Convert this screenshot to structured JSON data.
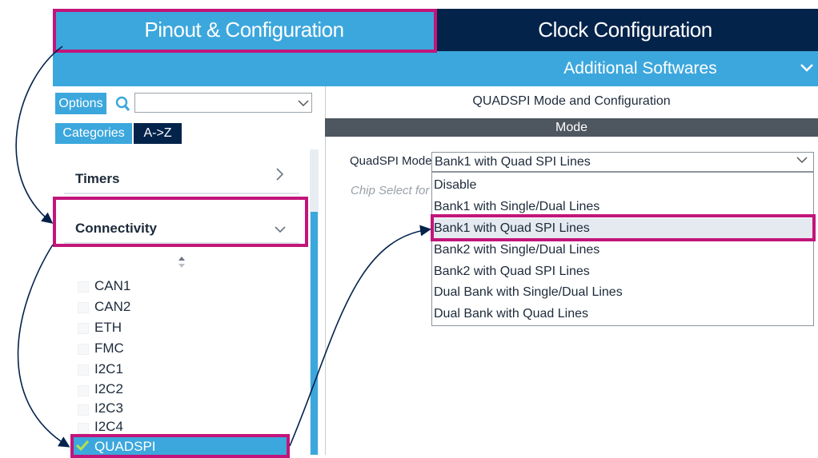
{
  "tabs": {
    "pinout": "Pinout & Configuration",
    "clock": "Clock Configuration"
  },
  "subbar": {
    "additional_softwares": "Additional Softwares"
  },
  "left": {
    "options_label": "Options",
    "search_placeholder": "",
    "categories_label": "Categories",
    "az_label": "A->Z",
    "categories": [
      {
        "label": "Timers"
      },
      {
        "label": "Connectivity"
      }
    ],
    "peripherals": [
      "CAN1",
      "CAN2",
      "ETH",
      "FMC",
      "I2C1",
      "I2C2",
      "I2C3",
      "I2C4"
    ],
    "selected_peripheral": "QUADSPI"
  },
  "right": {
    "title": "QUADSPI Mode and Configuration",
    "mode_header": "Mode",
    "quadspi_mode_label": "QuadSPI Mode",
    "selected_value": "Bank1 with Quad SPI Lines",
    "chip_select_label": "Chip Select for",
    "options": [
      "Disable",
      "Bank1 with Single/Dual Lines",
      "Bank1 with Quad SPI Lines",
      "Bank2 with Single/Dual Lines",
      "Bank2 with Quad SPI Lines",
      "Dual Bank with Single/Dual Lines",
      "Dual Bank with Quad Lines"
    ]
  },
  "colors": {
    "accent_blue": "#3ca7dd",
    "dark_navy": "#03234b",
    "highlight_magenta": "#c2157a",
    "mode_bar": "#4e565f"
  }
}
